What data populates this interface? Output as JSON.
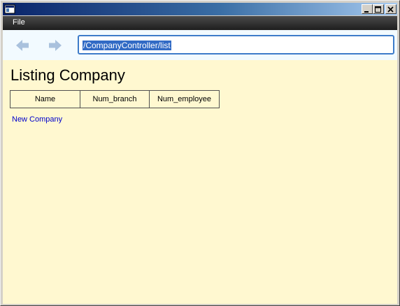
{
  "window": {
    "controls": [
      {
        "icon": "minimize-icon"
      },
      {
        "icon": "maximize-icon"
      },
      {
        "icon": "close-icon"
      }
    ]
  },
  "menu": {
    "items": [
      {
        "label": "File"
      }
    ]
  },
  "toolbar": {
    "back_icon": "back-arrow-icon",
    "forward_icon": "forward-arrow-icon",
    "address_value": "/CompanyController/list"
  },
  "page": {
    "title": "Listing Company",
    "table": {
      "columns": [
        "Name",
        "Num_branch",
        "Num_employee"
      ],
      "rows": []
    },
    "new_link": "New Company"
  },
  "colors": {
    "titlebar_start": "#0a246a",
    "titlebar_end": "#a6caf0",
    "menubar": "#2c2c2c",
    "toolbar_bg": "#f2faff",
    "content_bg": "#fff8d0",
    "link": "#0000cc",
    "selection": "#316ac5",
    "address_border": "#3d7bc9"
  }
}
